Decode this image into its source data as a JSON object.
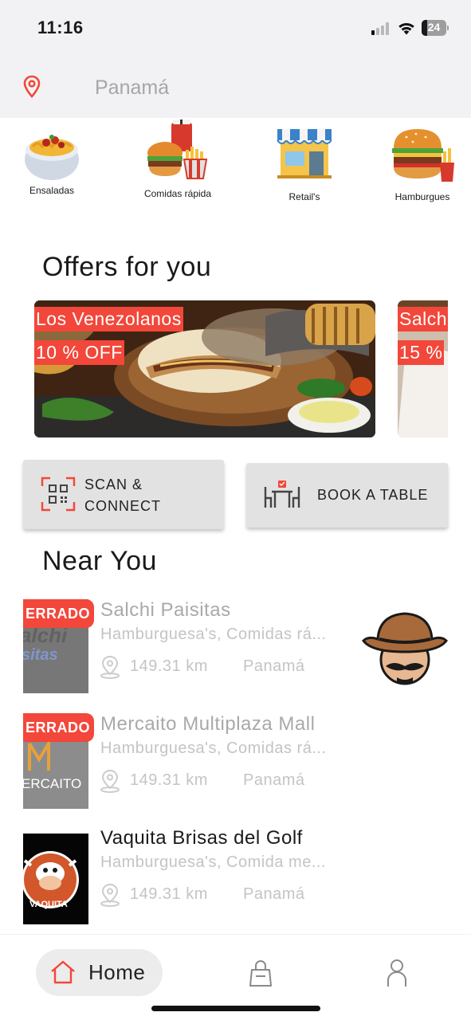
{
  "status_bar": {
    "time": "11:16",
    "battery": "24",
    "battery_level": 0.24
  },
  "location": {
    "city": "Panamá",
    "icon": "map-pin-icon",
    "accent": "#f2473a"
  },
  "categories": [
    {
      "label": "Ensaladas",
      "icon": "salad-bowl-icon"
    },
    {
      "label": "Comidas rápida",
      "icon": "fast-food-combo-icon"
    },
    {
      "label": "Retail's",
      "icon": "storefront-icon"
    },
    {
      "label": "Hamburgues",
      "icon": "burger-fries-icon"
    }
  ],
  "offers": {
    "title": "Offers for you",
    "items": [
      {
        "name": "Los Venezolanos",
        "discount": "10 % OFF"
      },
      {
        "name": "Salch",
        "discount": "15 %"
      }
    ]
  },
  "actions": {
    "scan_line1": "SCAN &",
    "scan_line2": "CONNECT",
    "book": "BOOK A TABLE"
  },
  "near_you": {
    "title": "Near You",
    "stores": [
      {
        "name": "Salchi Paisitas",
        "categories": "Hamburguesa's, Comidas rá...",
        "distance": "149.31 km",
        "city": "Panamá",
        "badge": "ERRADO",
        "closed": true
      },
      {
        "name": "Mercaito Multiplaza Mall",
        "categories": "Hamburguesa's, Comidas rá...",
        "distance": "149.31 km",
        "city": "Panamá",
        "badge": "ERRADO",
        "closed": true
      },
      {
        "name": "Vaquita Brisas del Golf",
        "categories": "Hamburguesa's, Comida me...",
        "distance": "149.31 km",
        "city": "Panamá",
        "badge": "",
        "closed": false
      }
    ]
  },
  "nav": {
    "home": "Home",
    "orders_icon": "shopping-bag-icon",
    "profile_icon": "user-icon"
  },
  "colors": {
    "accent": "#f2473a",
    "header_bg": "#f2f2f4",
    "muted_text": "#c4c4c4"
  }
}
